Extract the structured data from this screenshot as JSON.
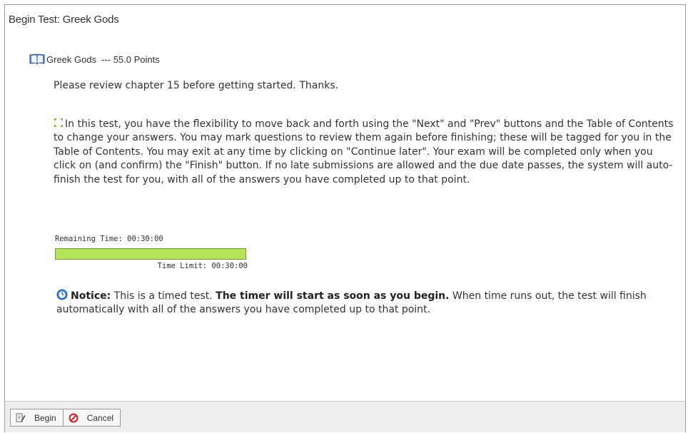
{
  "page": {
    "title": "Begin Test: Greek Gods"
  },
  "test": {
    "icon": "book-icon",
    "name": "Greek Gods",
    "points": "--- 55.0 Points",
    "description": "Please review chapter 15 before getting started. Thanks.",
    "instructions_icon": "expand-arrows-icon",
    "instructions": "In this test, you have the flexibility to move back and forth using the \"Next\" and \"Prev\" buttons and the Table of Contents to change your answers. You may mark questions to review them again before finishing; these will be tagged for you in the Table of Contents. You may exit at any time by clicking on \"Continue later\". Your exam will be completed only when you click on (and confirm) the \"Finish\" button. If no late submissions are allowed and the due date passes, the system will auto-finish the test for you, with all of the answers you have completed up to that point."
  },
  "timer": {
    "remaining": "Remaining Time: 00:30:00",
    "limit": "Time Limit: 00:30:00",
    "fill_fraction": 1.0,
    "fill_color": "#b5e55a"
  },
  "notice": {
    "icon": "clock-icon",
    "label": "Notice:",
    "text1": " This is a timed test. ",
    "bold": "The timer will start as soon as you begin.",
    "text2": " When time runs out, the test will finish automatically with all of the answers you have completed up to that point."
  },
  "toolbar": {
    "begin_label": "Begin",
    "begin_icon": "pencil-paper-icon",
    "cancel_label": "Cancel",
    "cancel_icon": "cancel-circle-icon"
  }
}
